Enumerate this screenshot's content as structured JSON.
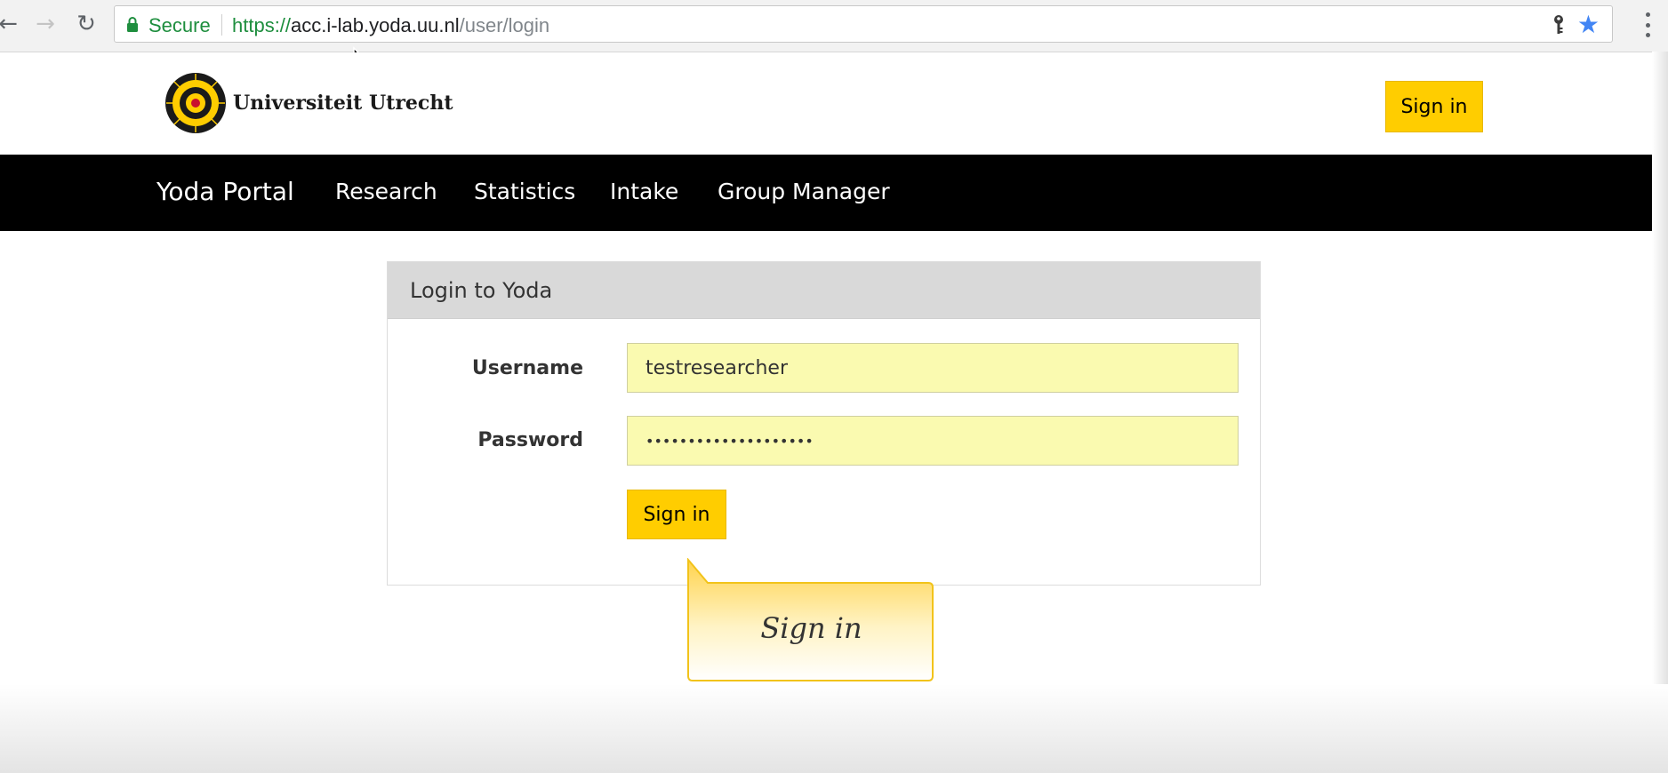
{
  "browser": {
    "back_icon": "arrow-left-icon",
    "forward_icon": "arrow-right-icon",
    "reload_icon": "reload-icon",
    "secure_label": "Secure",
    "url_scheme": "https://",
    "url_host": "acc.i-lab.yoda.uu.nl",
    "url_path": "/user/login",
    "accent_color": "#4285f4",
    "secure_color": "#1e8e3e"
  },
  "header": {
    "brand_name": "Universiteit Utrecht",
    "signin_label": "Sign in",
    "signin_color": "#ffcd00"
  },
  "navbar": {
    "brand": "Yoda Portal",
    "items": [
      {
        "label": "Research"
      },
      {
        "label": "Statistics"
      },
      {
        "label": "Intake"
      },
      {
        "label": "Group Manager"
      }
    ]
  },
  "login": {
    "title": "Login to Yoda",
    "username_label": "Username",
    "username_value": "testresearcher",
    "password_label": "Password",
    "password_value": "••••••••••••••••••••",
    "signin_label": "Sign in",
    "autofill_color": "#fafab0"
  },
  "callout": {
    "text": "Sign in"
  }
}
